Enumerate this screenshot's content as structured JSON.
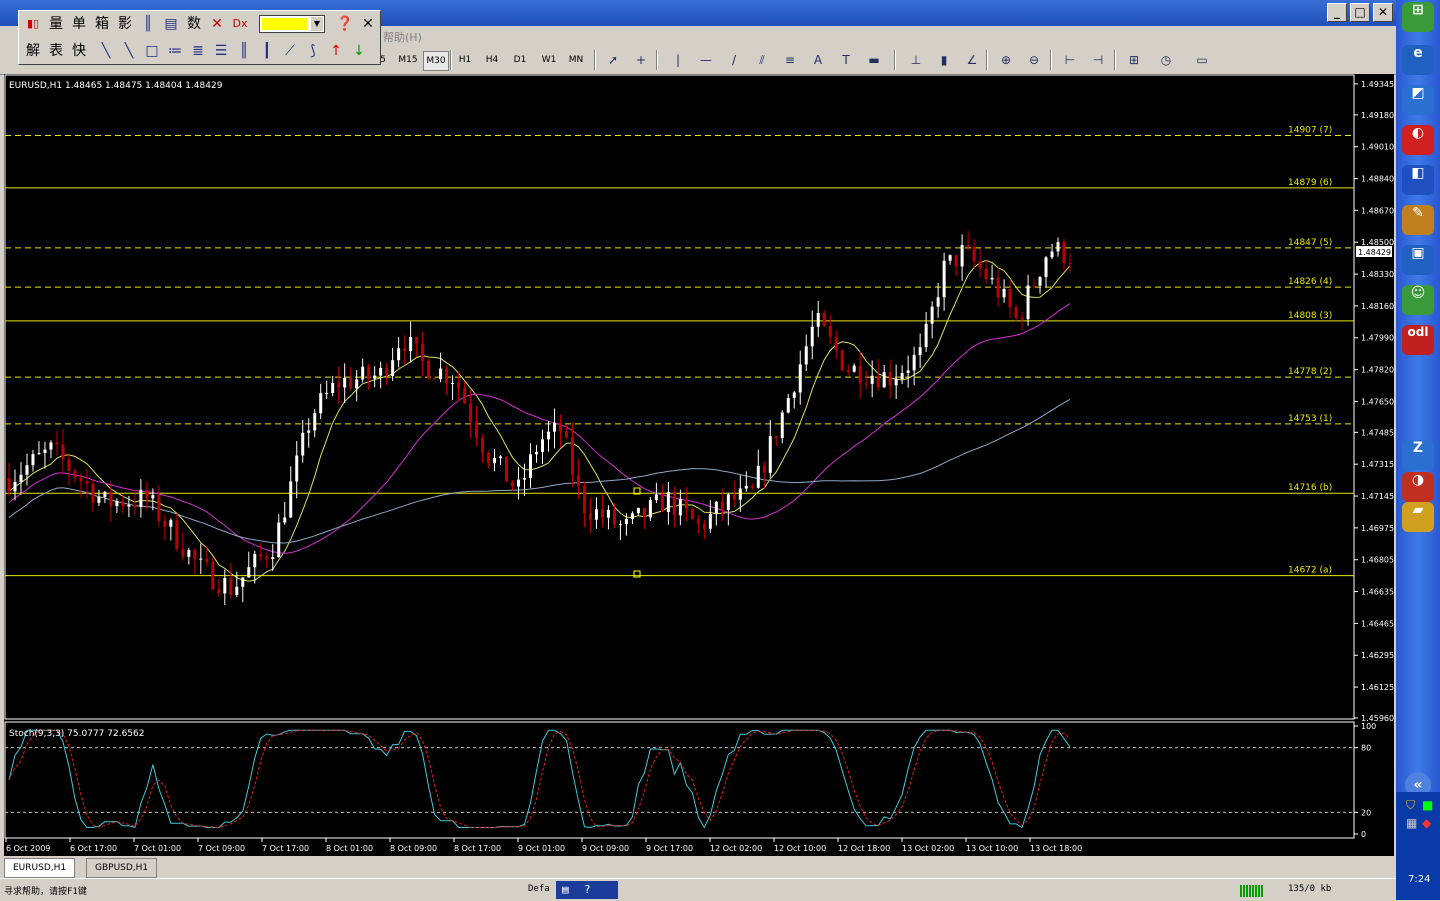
{
  "toolbar": {
    "timeframes": [
      "M15",
      "M30",
      "H1",
      "H4",
      "D1",
      "W1",
      "MN"
    ],
    "selected_timeframe": "M30",
    "menu_partial": "帮助(H)"
  },
  "floatbar": {
    "row1": [
      "量",
      "单",
      "箱",
      "影",
      "数"
    ],
    "row2": [
      "解",
      "表",
      "快"
    ],
    "color": "#ffff00"
  },
  "chart": {
    "header": "EURUSD,H1  1.48465 1.48475 1.48404 1.48429",
    "indicator_header": "Stoch(9,3,3) 75.0777 72.6562",
    "price_tag": "1.48429",
    "price_axis": [
      "1.49345",
      "1.49180",
      "1.49010",
      "1.48840",
      "1.48670",
      "1.48500",
      "1.48330",
      "1.48160",
      "1.47990",
      "1.47820",
      "1.47650",
      "1.47485",
      "1.47315",
      "1.47145",
      "1.46975",
      "1.46805",
      "1.46635",
      "1.46465",
      "1.46295",
      "1.46125",
      "1.45960"
    ],
    "stoch_axis": [
      "100",
      "80",
      "20",
      "0"
    ],
    "time_axis": [
      "6 Oct 2009",
      "6 Oct 17:00",
      "7 Oct 01:00",
      "7 Oct 09:00",
      "7 Oct 17:00",
      "8 Oct 01:00",
      "8 Oct 09:00",
      "8 Oct 17:00",
      "9 Oct 01:00",
      "9 Oct 09:00",
      "9 Oct 17:00",
      "12 Oct 02:00",
      "12 Oct 10:00",
      "12 Oct 18:00",
      "13 Oct 02:00",
      "13 Oct 10:00",
      "13 Oct 18:00"
    ],
    "levels": [
      {
        "label": "14907 (7)",
        "price": 1.4907,
        "dashed": true
      },
      {
        "label": "14879 (6)",
        "price": 1.4879,
        "dashed": false
      },
      {
        "label": "14847 (5)",
        "price": 1.4847,
        "dashed": true
      },
      {
        "label": "14826 (4)",
        "price": 1.4826,
        "dashed": true
      },
      {
        "label": "14808 (3)",
        "price": 1.4808,
        "dashed": false
      },
      {
        "label": "14778 (2)",
        "price": 1.4778,
        "dashed": true
      },
      {
        "label": "14753 (1)",
        "price": 1.4753,
        "dashed": true
      },
      {
        "label": "14716 (b)",
        "price": 1.4716,
        "dashed": false
      },
      {
        "label": "14672 (a)",
        "price": 1.4672,
        "dashed": false
      }
    ]
  },
  "colors": {
    "bull": "#ffffff",
    "bear": "#c00000",
    "level": "#e8e800",
    "ma_fast": "#d8e060",
    "ma_mid": "#d030d0",
    "ma_slow": "#8fa8c8",
    "stoch_main": "#40c8d8",
    "stoch_signal": "#e02020"
  },
  "chart_data": {
    "type": "candlestick",
    "title": "EURUSD,H1",
    "y_range": [
      1.4596,
      1.4935
    ],
    "ohlc_summary": {
      "open": 1.48465,
      "high": 1.48475,
      "low": 1.48404,
      "close": 1.48429
    },
    "stochastic": {
      "main": 75.0777,
      "signal": 72.6562,
      "levels": [
        80,
        20
      ]
    }
  },
  "tabs": [
    "EURUSD,H1",
    "GBPUSD,H1"
  ],
  "status": {
    "help": "寻求帮助，请按F1键",
    "profile": "Default",
    "traffic": "135/0 kb"
  },
  "taskbar": {
    "clock": "7:24"
  }
}
